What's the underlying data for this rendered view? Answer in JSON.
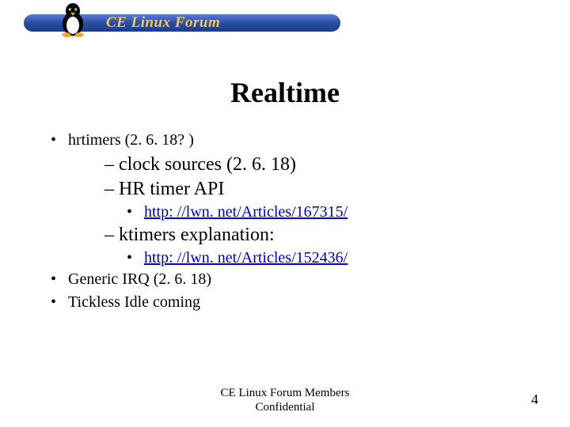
{
  "header": {
    "forum_name": "CE Linux Forum"
  },
  "title": "Realtime",
  "bullets": {
    "hrtimers": "hrtimers (2. 6. 18? )",
    "clock_sources": "– clock sources (2. 6. 18)",
    "hr_api": "– HR timer API",
    "link1": "http: //lwn. net/Articles/167315/",
    "ktimers": "– ktimers explanation:",
    "link2": "http: //lwn. net/Articles/152436/",
    "generic_irq": "Generic IRQ (2. 6. 18)",
    "tickless": "Tickless Idle coming"
  },
  "footer": {
    "line1": "CE Linux Forum Members",
    "line2": "Confidential"
  },
  "page_number": "4"
}
